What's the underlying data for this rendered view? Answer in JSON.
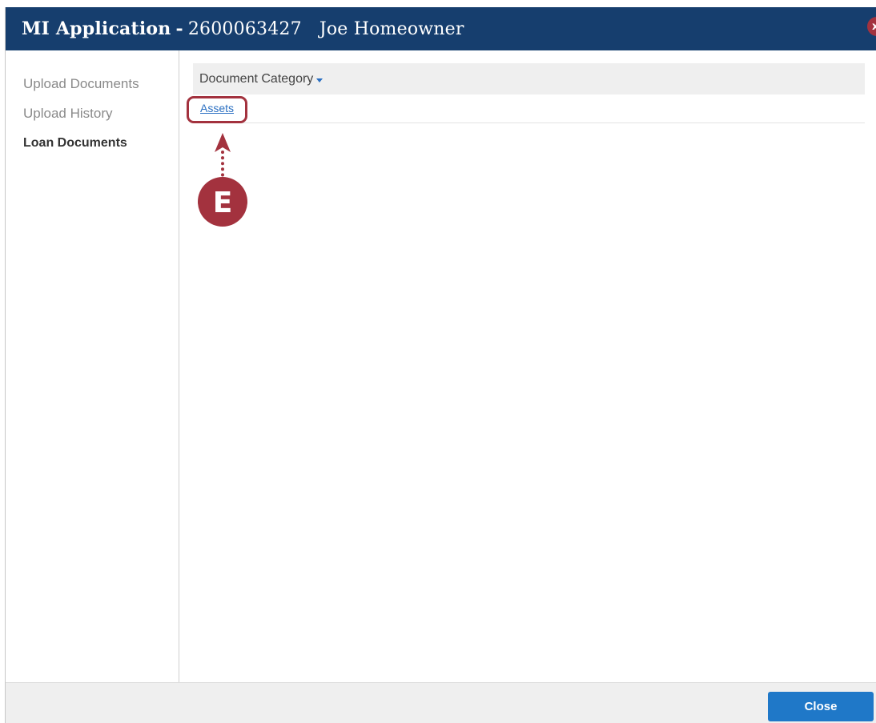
{
  "title": {
    "app": "MI Application",
    "separator": "-",
    "number": "2600063427",
    "borrower": "Joe Homeowner"
  },
  "window_close_glyph": "x",
  "sidebar": {
    "items": [
      {
        "label": "Upload Documents",
        "active": false
      },
      {
        "label": "Upload History",
        "active": false
      },
      {
        "label": "Loan Documents",
        "active": true
      }
    ]
  },
  "table": {
    "header": "Document Category",
    "rows": [
      {
        "label": "Assets"
      }
    ]
  },
  "callout": {
    "letter": "E",
    "color": "#a3323e"
  },
  "footer": {
    "close_label": "Close"
  },
  "colors": {
    "titlebar": "#163e6e",
    "primary_button": "#1f78c8",
    "link": "#2a6fc2",
    "accent": "#a3323e"
  },
  "icons": {
    "window_close": "close-icon",
    "sort": "caret-down-icon"
  }
}
